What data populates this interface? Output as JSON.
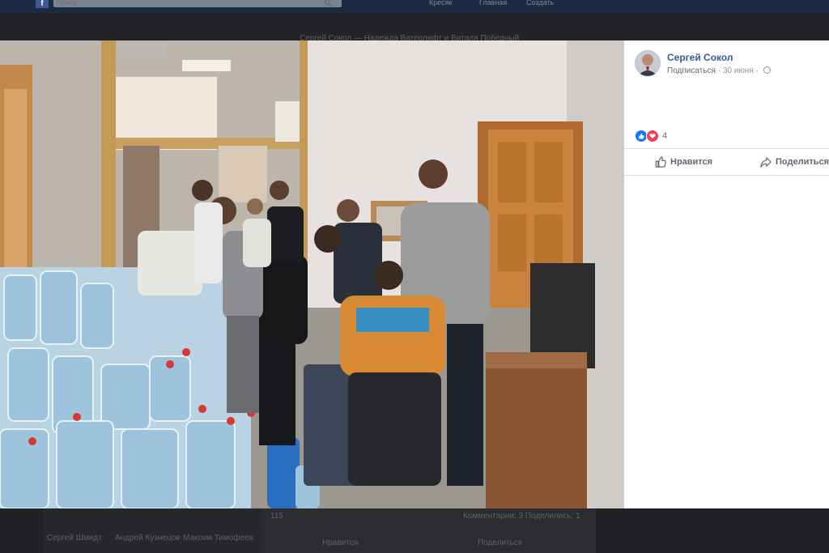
{
  "background": {
    "search_placeholder": "Поиск",
    "nav": [
      "Кресяк",
      "Главная",
      "Создать"
    ],
    "post_header": "Сергей Сокол — Надежда Ватерлифт и Виталя Победный",
    "friends": [
      "Сергей Шмидт",
      "Андрей Кузнецов",
      "Максим Тимофеев"
    ],
    "comments_shares": "Комментарии: 3  Поделились: 1",
    "reactions_count": "115",
    "like_label": "Нравится",
    "share_label": "Поделиться"
  },
  "post": {
    "author": "Сергей Сокол",
    "subscribe": "Подписаться",
    "date": "30 июня",
    "privacy_icon": "globe-icon",
    "reactions": {
      "icons": [
        "like-icon",
        "love-icon"
      ],
      "count": "4"
    },
    "actions": {
      "like": "Нравится",
      "share": "Поделиться"
    }
  },
  "colors": {
    "link": "#385898",
    "like": "#1877f2",
    "love": "#f33e58"
  }
}
